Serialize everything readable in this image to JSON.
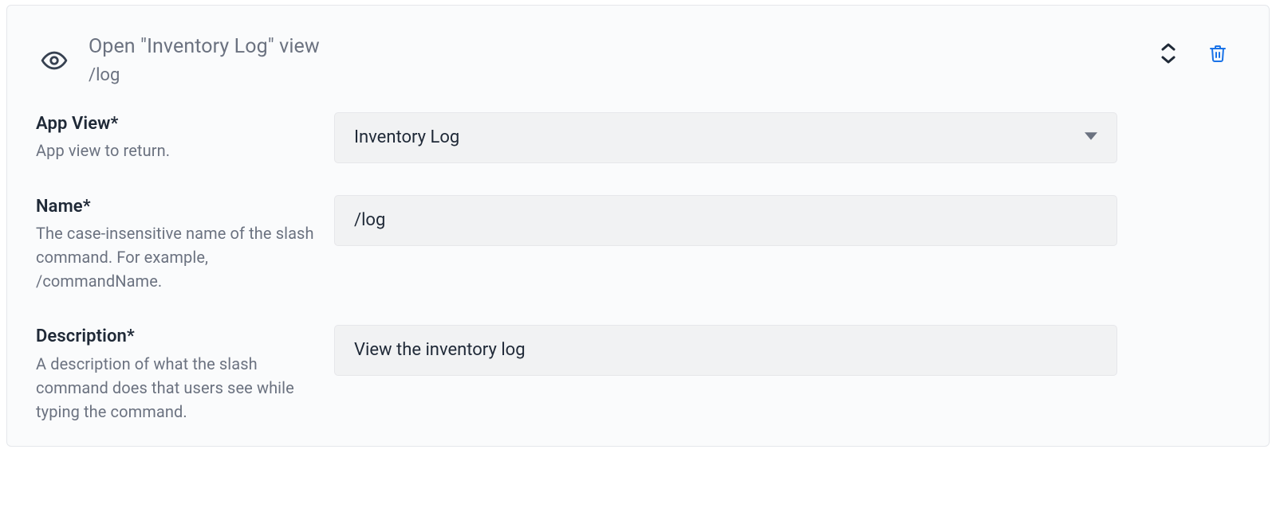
{
  "header": {
    "title": "Open \"Inventory Log\" view",
    "subtitle": "/log"
  },
  "fields": {
    "appView": {
      "label": "App View*",
      "help": "App view to return.",
      "value": "Inventory Log"
    },
    "name": {
      "label": "Name*",
      "help": "The case-insensitive name of the slash command. For example, /commandName.",
      "value": "/log"
    },
    "description": {
      "label": "Description*",
      "help": "A description of what the slash command does that users see while typing the command.",
      "value": "View the inventory log"
    }
  },
  "colors": {
    "trash": "#1a73e8",
    "muted": "#6b7280",
    "text": "#1f2937"
  }
}
